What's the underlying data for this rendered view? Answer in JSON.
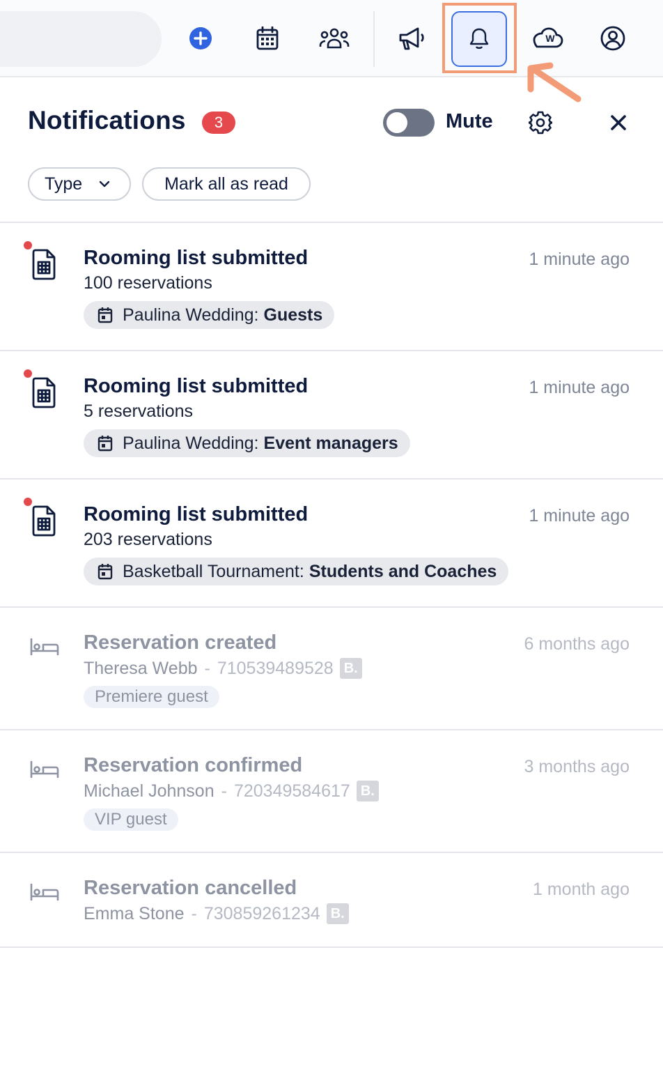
{
  "topbar": {
    "icons": [
      "plus-circle-icon",
      "calendar-icon",
      "people-icon",
      "megaphone-icon",
      "bell-icon",
      "cloud-w-icon",
      "user-circle-icon"
    ],
    "accent": "#2f63e0",
    "highlight": "#f39a76"
  },
  "header": {
    "title": "Notifications",
    "count": "3",
    "mute_label": "Mute"
  },
  "filters": {
    "type_label": "Type",
    "mark_all_label": "Mark all as read"
  },
  "notifications": [
    {
      "state": "unread",
      "icon": "spreadsheet-file-icon",
      "title": "Rooming list submitted",
      "time": "1 minute ago",
      "subtitle": "100 reservations",
      "tag_event": "Paulina Wedding:",
      "tag_group": "Guests"
    },
    {
      "state": "unread",
      "icon": "spreadsheet-file-icon",
      "title": "Rooming list submitted",
      "time": "1 minute ago",
      "subtitle": "5 reservations",
      "tag_event": "Paulina Wedding:",
      "tag_group": "Event managers"
    },
    {
      "state": "unread",
      "icon": "spreadsheet-file-icon",
      "title": "Rooming list submitted",
      "time": "1 minute ago",
      "subtitle": "203 reservations",
      "tag_event": "Basketball Tournament:",
      "tag_group": "Students and Coaches"
    },
    {
      "state": "read",
      "icon": "bed-icon",
      "title": "Reservation created",
      "time": "6 months ago",
      "guest_name": "Theresa Webb",
      "separator": "-",
      "reservation_number": "710539489528",
      "source_badge": "B.",
      "guest_tag": "Premiere guest"
    },
    {
      "state": "read",
      "icon": "bed-icon",
      "title": "Reservation confirmed",
      "time": "3 months ago",
      "guest_name": "Michael Johnson",
      "separator": "-",
      "reservation_number": "720349584617",
      "source_badge": "B.",
      "guest_tag": "VIP guest"
    },
    {
      "state": "read",
      "icon": "bed-icon",
      "title": "Reservation cancelled",
      "time": "1 month ago",
      "guest_name": "Emma Stone",
      "separator": "-",
      "reservation_number": "730859261234",
      "source_badge": "B."
    }
  ]
}
